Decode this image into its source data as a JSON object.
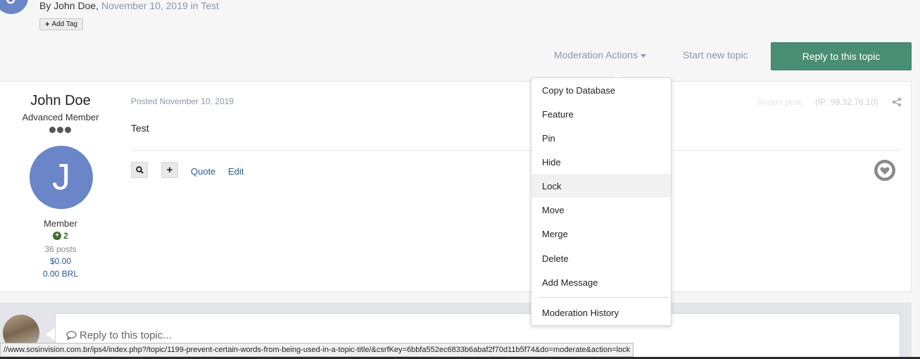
{
  "header": {
    "avatar_letter": "J",
    "byline_prefix": "By John Doe,",
    "byline_date": "November 10, 2019 in Test",
    "add_tag_label": "Add Tag"
  },
  "toolbar": {
    "moderation_actions": "Moderation Actions",
    "start_new_topic": "Start new topic",
    "reply_button": "Reply to this topic"
  },
  "post": {
    "author_name": "John Doe",
    "author_title": "Advanced Member",
    "avatar_letter": "J",
    "group": "Member",
    "reputation": "2",
    "post_count": "36 posts",
    "balance_usd": "$0.00",
    "balance_brl": "0.00 BRL",
    "posted": "Posted November 10, 2019",
    "report": "Report post",
    "ip": "(IP: 99.32.78.10)",
    "content": "Test",
    "quote_label": "Quote",
    "edit_label": "Edit"
  },
  "reply": {
    "placeholder": "Reply to this topic..."
  },
  "dropdown": {
    "items": [
      {
        "label": "Copy to Database"
      },
      {
        "label": "Feature"
      },
      {
        "label": "Pin"
      },
      {
        "label": "Hide"
      },
      {
        "label": "Lock"
      },
      {
        "label": "Move"
      },
      {
        "label": "Merge"
      },
      {
        "label": "Delete"
      },
      {
        "label": "Add Message"
      },
      {
        "label": "Moderation History"
      }
    ],
    "active_index": 4
  },
  "statusbar": {
    "url": "//www.sosinvision.com.br/ips4/index.php?/topic/1199-prevent-certain-words-from-being-used-in-a-topic-title/&csrfKey=6bbfa552ec6833b6abaf2f70d11b5f74&do=moderate&action=lock"
  },
  "colors": {
    "accent_green": "#4a8d75",
    "avatar_blue": "#6a85c8",
    "link_blue": "#2c5a8c",
    "muted": "#8a97a8"
  }
}
